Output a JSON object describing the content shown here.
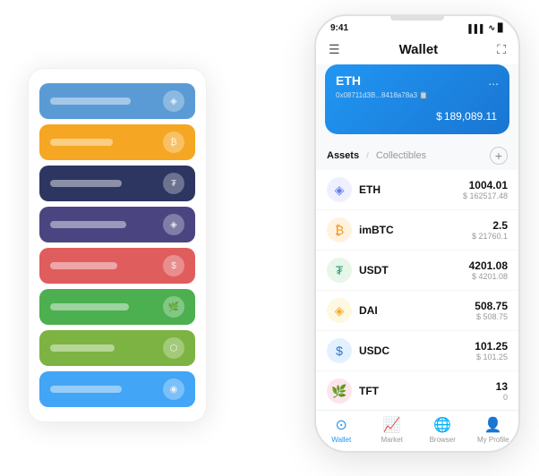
{
  "phone": {
    "status_bar": {
      "time": "9:41",
      "signal": "▌▌▌",
      "wifi": "WiFi",
      "battery": "▊"
    },
    "header": {
      "menu_icon": "☰",
      "title": "Wallet",
      "expand_icon": "⛶"
    },
    "eth_card": {
      "title": "ETH",
      "address": "0x08711d3B...8418a78a3 📋",
      "menu": "...",
      "balance_symbol": "$",
      "balance": "189,089.11"
    },
    "assets_section": {
      "tab_active": "Assets",
      "tab_divider": "/",
      "tab_inactive": "Collectibles",
      "add_label": "+"
    },
    "assets": [
      {
        "name": "ETH",
        "icon": "◈",
        "icon_color": "#627EEA",
        "icon_bg": "#EEF0FF",
        "amount": "1004.01",
        "usd": "$ 162517.48"
      },
      {
        "name": "imBTC",
        "icon": "₿",
        "icon_color": "#F7931A",
        "icon_bg": "#FFF3E0",
        "amount": "2.5",
        "usd": "$ 21760.1"
      },
      {
        "name": "USDT",
        "icon": "₮",
        "icon_color": "#26A17B",
        "icon_bg": "#E8F5E9",
        "amount": "4201.08",
        "usd": "$ 4201.08"
      },
      {
        "name": "DAI",
        "icon": "◈",
        "icon_color": "#F5AC37",
        "icon_bg": "#FFF8E1",
        "amount": "508.75",
        "usd": "$ 508.75"
      },
      {
        "name": "USDC",
        "icon": "$",
        "icon_color": "#2775CA",
        "icon_bg": "#E3F0FF",
        "amount": "101.25",
        "usd": "$ 101.25"
      },
      {
        "name": "TFT",
        "icon": "🌿",
        "icon_color": "#E91E63",
        "icon_bg": "#FCE4EC",
        "amount": "13",
        "usd": "0"
      }
    ],
    "nav": [
      {
        "label": "Wallet",
        "icon": "⊙",
        "active": true
      },
      {
        "label": "Market",
        "icon": "📈",
        "active": false
      },
      {
        "label": "Browser",
        "icon": "🌐",
        "active": false
      },
      {
        "label": "My Profile",
        "icon": "👤",
        "active": false
      }
    ]
  },
  "card_stack": {
    "cards": [
      {
        "color": "#5B9BD5",
        "label_width": 90
      },
      {
        "color": "#F5A623",
        "label_width": 70
      },
      {
        "color": "#2D3561",
        "label_width": 80
      },
      {
        "color": "#4A4580",
        "label_width": 85
      },
      {
        "color": "#E05D5D",
        "label_width": 75
      },
      {
        "color": "#4CAF50",
        "label_width": 88
      },
      {
        "color": "#7CB342",
        "label_width": 72
      },
      {
        "color": "#42A5F5",
        "label_width": 80
      }
    ]
  }
}
